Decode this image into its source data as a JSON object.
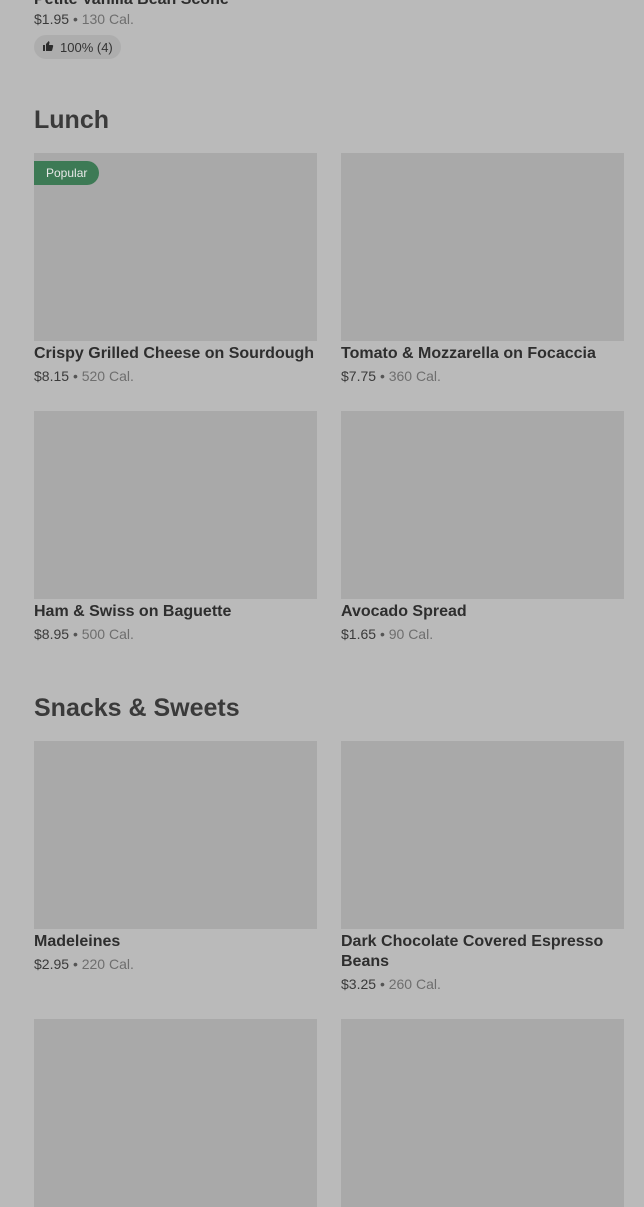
{
  "top_item": {
    "name": "Petite Vanilla Bean Scone",
    "price": "$1.95",
    "calories": "130 Cal.",
    "rating": "100% (4)"
  },
  "separator": "•",
  "sections": [
    {
      "title": "Lunch",
      "items": [
        {
          "name": "Crispy Grilled Cheese on Sourdough",
          "price": "$8.15",
          "calories": "520 Cal.",
          "badge": "Popular"
        },
        {
          "name": "Tomato & Mozzarella on Focaccia",
          "price": "$7.75",
          "calories": "360 Cal."
        },
        {
          "name": "Ham & Swiss on Baguette",
          "price": "$8.95",
          "calories": "500 Cal."
        },
        {
          "name": "Avocado Spread",
          "price": "$1.65",
          "calories": "90 Cal."
        }
      ]
    },
    {
      "title": "Snacks & Sweets",
      "items": [
        {
          "name": "Madeleines",
          "price": "$2.95",
          "calories": "220 Cal."
        },
        {
          "name": "Dark Chocolate Covered Espresso Beans",
          "price": "$3.25",
          "calories": "260 Cal."
        }
      ]
    }
  ],
  "icons": {
    "rating": "thumbs-up-icon"
  }
}
